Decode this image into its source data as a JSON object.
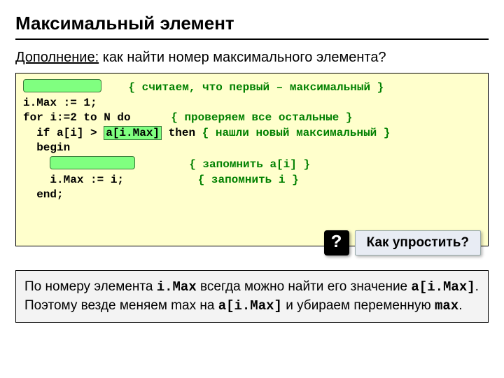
{
  "title": "Максимальный элемент",
  "subtitle_prefix": "Дополнение:",
  "subtitle_rest": " как найти номер максимального элемента?",
  "code": {
    "comment1": "{ считаем, что первый – максимальный }",
    "l2": "i.Max := 1;",
    "l3a": "for i:=2 to N do",
    "l3b": "{ проверяем все остальные }",
    "l4a": "  if a[i] > ",
    "l4hl": "a[i.Max]",
    "l4b": " then ",
    "l4c": "{ нашли новый максимальный }",
    "l5": "  begin",
    "l6c": "{ запомнить a[i] }",
    "l7": "    i.Max := i;",
    "l7c": "{ запомнить i }",
    "l8": "  end;"
  },
  "callout": {
    "mark": "?",
    "text": "Как упростить?"
  },
  "note": {
    "t1": "По номеру элемента ",
    "m1": "i.Max",
    "t2": " всегда можно найти его значение ",
    "m2": "a[i.Max]",
    "t3": ". Поэтому везде меняем max на ",
    "m3": "a[i.Max]",
    "t4": " и убираем переменную ",
    "m4": "max",
    "t5": "."
  }
}
